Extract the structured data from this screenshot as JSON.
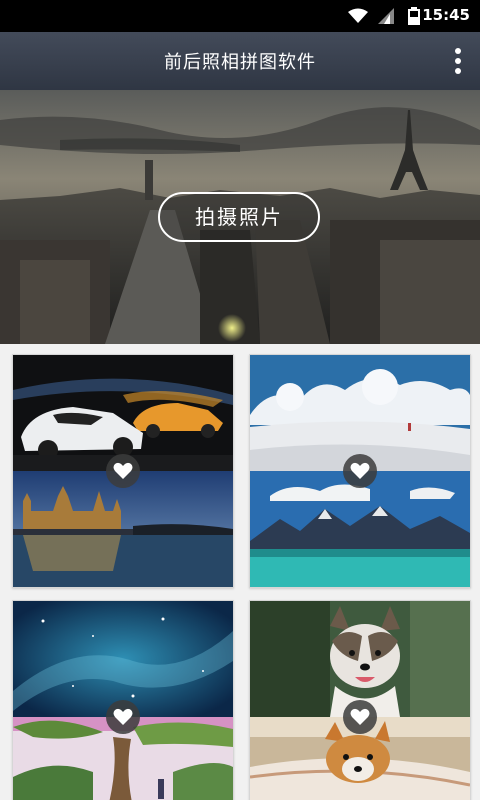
{
  "status_bar": {
    "time": "15:45",
    "icons": [
      "wifi-icon",
      "signal-icon",
      "battery-icon"
    ]
  },
  "app_bar": {
    "title": "前后照相拼图软件",
    "menu_icon": "overflow-menu-icon"
  },
  "hero": {
    "capture_label": "拍摄照片"
  },
  "colors": {
    "app_bar": "#3a4250",
    "status_bar": "#000000",
    "background": "#f1f1f1"
  },
  "collage_cards": [
    {
      "top_photo": "white and orange sports cars",
      "bottom_photo": "cathedral by river at dusk",
      "icon": "heart-icon"
    },
    {
      "top_photo": "clouds over snowy dunes",
      "bottom_photo": "mountains and turquoise lake",
      "icon": "heart-icon"
    },
    {
      "top_photo": "starry night sky",
      "bottom_photo": "anime garden with tree",
      "icon": "heart-icon"
    },
    {
      "top_photo": "corgi dog portrait",
      "bottom_photo": "corgi lying on bed",
      "icon": "heart-icon"
    }
  ]
}
